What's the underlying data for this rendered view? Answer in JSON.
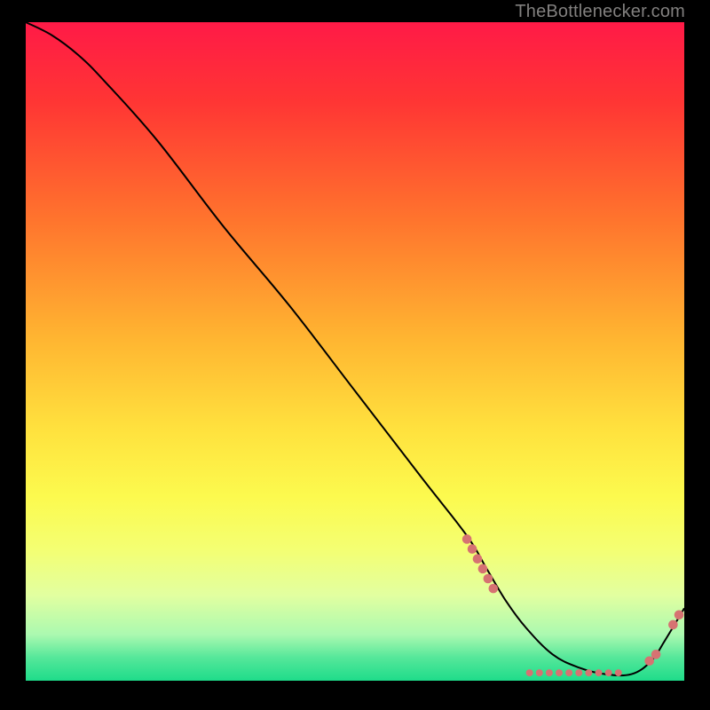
{
  "watermark": "TheBottleneсker.com",
  "chart_data": {
    "type": "line",
    "title": "",
    "xlabel": "",
    "ylabel": "",
    "xlim": [
      0,
      100
    ],
    "ylim": [
      0,
      100
    ],
    "grid": false,
    "legend": false,
    "background_gradient": {
      "stops": [
        {
          "offset": 0.0,
          "color": "#ff1a47"
        },
        {
          "offset": 0.12,
          "color": "#ff3534"
        },
        {
          "offset": 0.3,
          "color": "#ff742d"
        },
        {
          "offset": 0.48,
          "color": "#ffb531"
        },
        {
          "offset": 0.62,
          "color": "#ffe23e"
        },
        {
          "offset": 0.72,
          "color": "#fcfa4e"
        },
        {
          "offset": 0.8,
          "color": "#f4ff72"
        },
        {
          "offset": 0.87,
          "color": "#e2ffa0"
        },
        {
          "offset": 0.93,
          "color": "#abf9b0"
        },
        {
          "offset": 0.965,
          "color": "#55e79a"
        },
        {
          "offset": 1.0,
          "color": "#1edc8a"
        }
      ]
    },
    "series": [
      {
        "name": "bottleneck-curve",
        "color": "#000000",
        "width": 2,
        "x": [
          0,
          4,
          8,
          12,
          20,
          30,
          40,
          50,
          60,
          67,
          70,
          73,
          76,
          80,
          84,
          88,
          92,
          95,
          97,
          100
        ],
        "y": [
          100,
          98,
          95,
          91,
          82,
          69,
          57,
          44,
          31,
          22,
          17,
          12,
          8,
          4,
          2,
          1,
          1,
          3,
          6,
          11
        ]
      }
    ],
    "markers": [
      {
        "name": "cluster-left",
        "color": "#d67272",
        "r": 5.3,
        "points": [
          {
            "x": 67.0,
            "y": 21.5
          },
          {
            "x": 67.8,
            "y": 20.0
          },
          {
            "x": 68.6,
            "y": 18.5
          },
          {
            "x": 69.4,
            "y": 17.0
          },
          {
            "x": 70.2,
            "y": 15.5
          },
          {
            "x": 71.0,
            "y": 14.0
          }
        ]
      },
      {
        "name": "cluster-bottom",
        "color": "#d67272",
        "r": 4.0,
        "points": [
          {
            "x": 76.5,
            "y": 1.2
          },
          {
            "x": 78.0,
            "y": 1.2
          },
          {
            "x": 79.5,
            "y": 1.2
          },
          {
            "x": 81.0,
            "y": 1.2
          },
          {
            "x": 82.5,
            "y": 1.2
          },
          {
            "x": 84.0,
            "y": 1.2
          },
          {
            "x": 85.5,
            "y": 1.2
          },
          {
            "x": 87.0,
            "y": 1.2
          },
          {
            "x": 88.5,
            "y": 1.2
          },
          {
            "x": 90.0,
            "y": 1.2
          }
        ]
      },
      {
        "name": "cluster-right",
        "color": "#d67272",
        "r": 5.3,
        "points": [
          {
            "x": 94.7,
            "y": 3.0
          },
          {
            "x": 95.7,
            "y": 4.0
          },
          {
            "x": 98.3,
            "y": 8.5
          },
          {
            "x": 99.2,
            "y": 10.0
          }
        ]
      }
    ]
  }
}
